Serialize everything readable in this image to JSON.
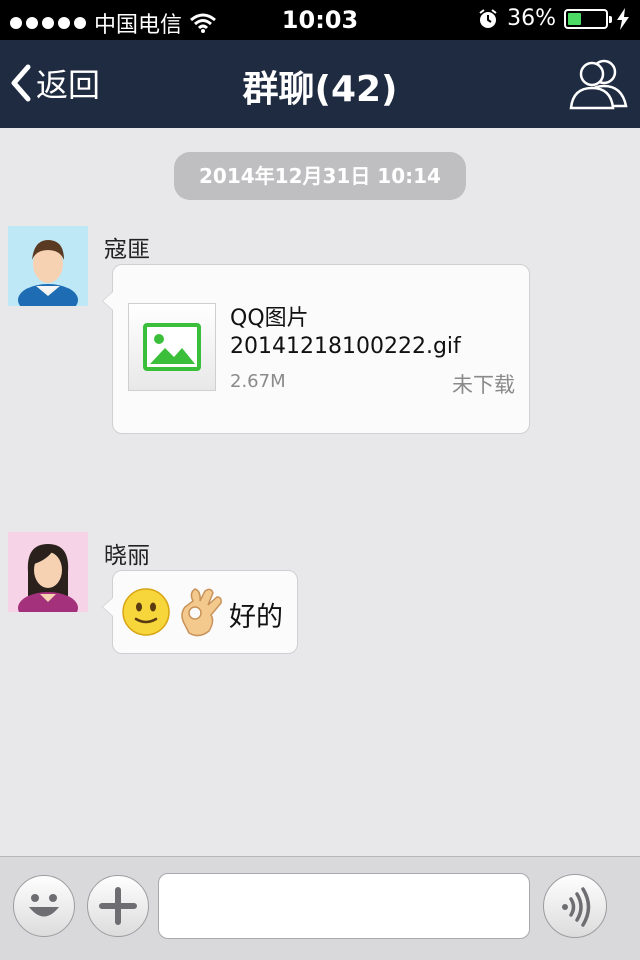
{
  "status_bar": {
    "carrier": "中国电信",
    "time": "10:03",
    "battery_percent": "36%",
    "battery_level": 0.36,
    "icons": [
      "signal-dots",
      "wifi-icon",
      "alarm-icon",
      "battery-icon",
      "charging-bolt-icon"
    ]
  },
  "nav": {
    "back_label": "返回",
    "title": "群聊(42)",
    "right_icon": "group-members-icon"
  },
  "chat": {
    "timestamp": "2014年12月31日 10:14",
    "messages": [
      {
        "sender": "寇匪",
        "avatar": "male-avatar",
        "type": "file",
        "file_title": "QQ图片",
        "file_name": "20141218100222.gif",
        "file_size": "2.67M",
        "file_status": "未下载",
        "file_icon": "image-file-icon"
      },
      {
        "sender": "晓丽",
        "avatar": "female-avatar",
        "type": "text",
        "emojis": [
          "smile-emoji",
          "ok-hand-emoji"
        ],
        "text": "好的"
      }
    ]
  },
  "input_bar": {
    "emoji_button_icon": "emoji-face-icon",
    "plus_button_icon": "plus-icon",
    "voice_button_icon": "voice-wave-icon",
    "input_value": "",
    "input_placeholder": ""
  },
  "colors": {
    "nav_bg": "#1f2b40",
    "chat_bg": "#e8e8ea",
    "timestamp_bg": "#bfbfc1",
    "file_icon_green": "#3bbf3b",
    "battery_green": "#4cd964"
  }
}
